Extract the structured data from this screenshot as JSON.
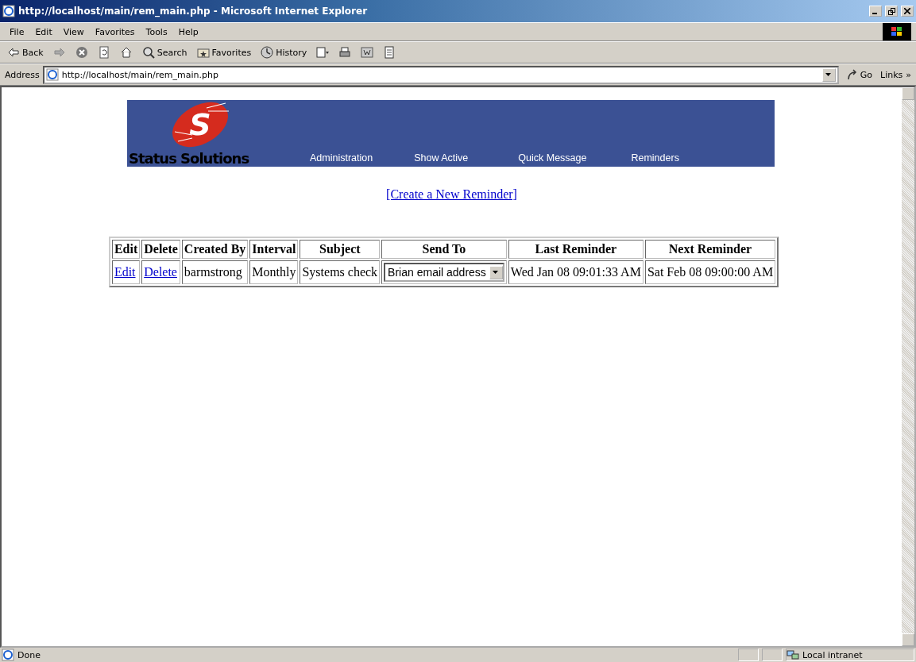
{
  "window": {
    "title": "http://localhost/main/rem_main.php - Microsoft Internet Explorer"
  },
  "menu": [
    "File",
    "Edit",
    "View",
    "Favorites",
    "Tools",
    "Help"
  ],
  "toolbar": [
    {
      "kind": "back",
      "label": "Back"
    },
    {
      "kind": "forward"
    },
    {
      "kind": "stop"
    },
    {
      "kind": "refresh"
    },
    {
      "kind": "home"
    },
    {
      "kind": "search",
      "label": "Search"
    },
    {
      "kind": "favorites",
      "label": "Favorites"
    },
    {
      "kind": "history",
      "label": "History"
    },
    {
      "kind": "mail"
    },
    {
      "kind": "print"
    },
    {
      "kind": "edit"
    },
    {
      "kind": "discuss"
    }
  ],
  "address": {
    "label": "Address",
    "value": "http://localhost/main/rem_main.php",
    "go": "Go",
    "links": "Links",
    "links_more": "»"
  },
  "banner": {
    "logo_letter": "S",
    "logo_text": "Status Solutions",
    "nav": [
      "Administration",
      "Show Active",
      "Quick Message",
      "Reminders"
    ]
  },
  "create_link": "[Create a New Reminder]",
  "table": {
    "columns": [
      "Edit",
      "Delete",
      "Created By",
      "Interval",
      "Subject",
      "Send To",
      "Last Reminder",
      "Next Reminder"
    ],
    "rows": [
      {
        "edit": "Edit",
        "delete": "Delete",
        "created_by": "barmstrong",
        "interval": "Monthly",
        "subject": "Systems check",
        "send_to": "Brian email address",
        "last": "Wed Jan 08 09:01:33 AM",
        "next": "Sat Feb 08 09:00:00 AM"
      }
    ]
  },
  "status_bar": {
    "text": "Done",
    "zone": "Local intranet"
  }
}
